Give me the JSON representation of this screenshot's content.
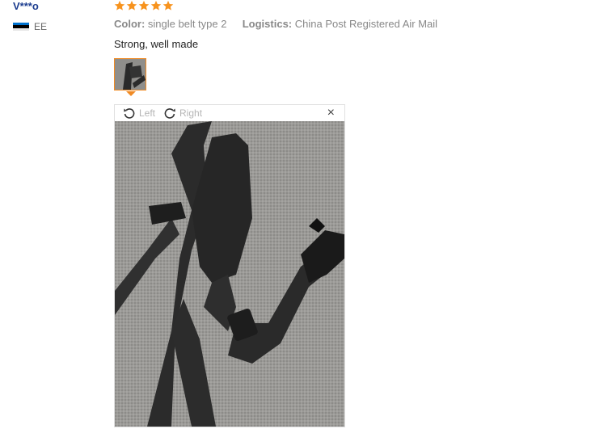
{
  "reviewer": {
    "name": "V***o",
    "country": "EE"
  },
  "rating": {
    "stars": 5,
    "color": "#f7931e"
  },
  "attributes": {
    "color_label": "Color:",
    "color_value": "single belt type 2",
    "logistics_label": "Logistics:",
    "logistics_value": "China Post Registered Air Mail"
  },
  "review": {
    "text": "Strong, well made"
  },
  "viewer": {
    "rotate_left_label": "Left",
    "rotate_right_label": "Right",
    "close_glyph": "×",
    "icons": [
      "rotate-left-icon",
      "rotate-right-icon",
      "close-icon"
    ]
  },
  "colors": {
    "accent": "#f08a24",
    "link": "#1c3d8f"
  }
}
